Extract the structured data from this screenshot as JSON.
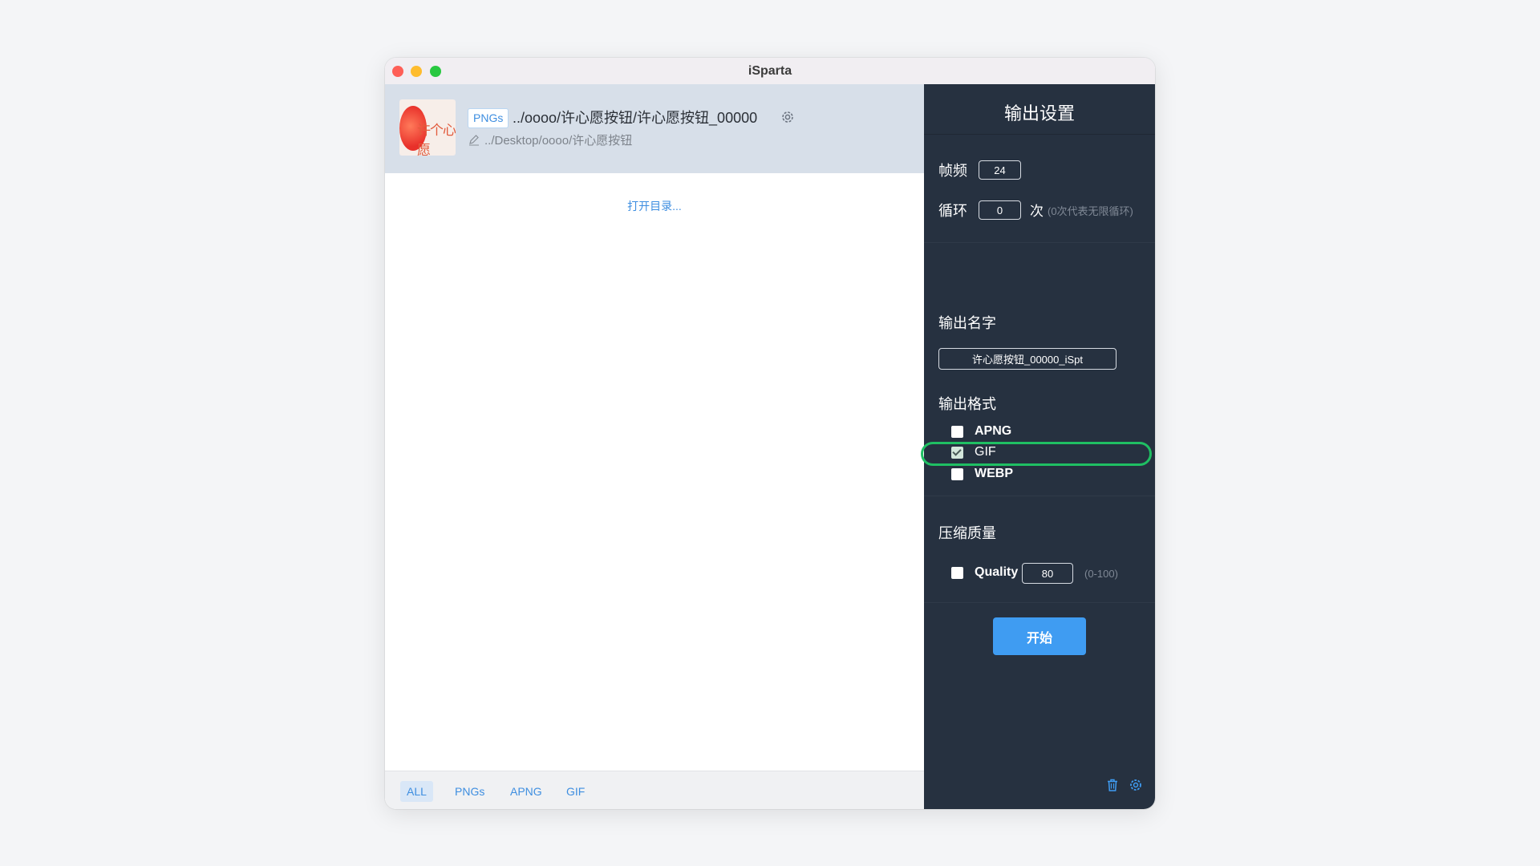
{
  "window": {
    "title": "iSparta"
  },
  "file": {
    "badge": "PNGs",
    "name": "../oooo/许心愿按钮/许心愿按钮_00000",
    "path": "../Desktop/oooo/许心愿按钮",
    "thumb_text": "许个心愿"
  },
  "left": {
    "open_dir": "打开目录...",
    "filters": [
      "ALL",
      "PNGs",
      "APNG",
      "GIF"
    ],
    "active_filter": "ALL"
  },
  "settings": {
    "title": "输出设置",
    "fps_label": "帧频",
    "fps_value": "24",
    "loop_label": "循环",
    "loop_value": "0",
    "loop_unit": "次",
    "loop_hint": "(0次代表无限循环)",
    "output_name_label": "输出名字",
    "output_name_value": "许心愿按钮_00000_iSpt",
    "output_format_label": "输出格式",
    "formats": [
      {
        "label": "APNG",
        "checked": false
      },
      {
        "label": "GIF",
        "checked": true
      },
      {
        "label": "WEBP",
        "checked": false
      }
    ],
    "quality_section_label": "压缩质量",
    "quality_label": "Quality",
    "quality_value": "80",
    "quality_hint": "(0-100)",
    "start_label": "开始"
  },
  "colors": {
    "accent": "#3f9cf2",
    "panel": "#263140",
    "highlight": "#1fbf63",
    "selected_row": "#d7dfe9"
  },
  "icons": [
    "settings-icon",
    "pencil-icon",
    "trash-icon",
    "gear-icon"
  ]
}
